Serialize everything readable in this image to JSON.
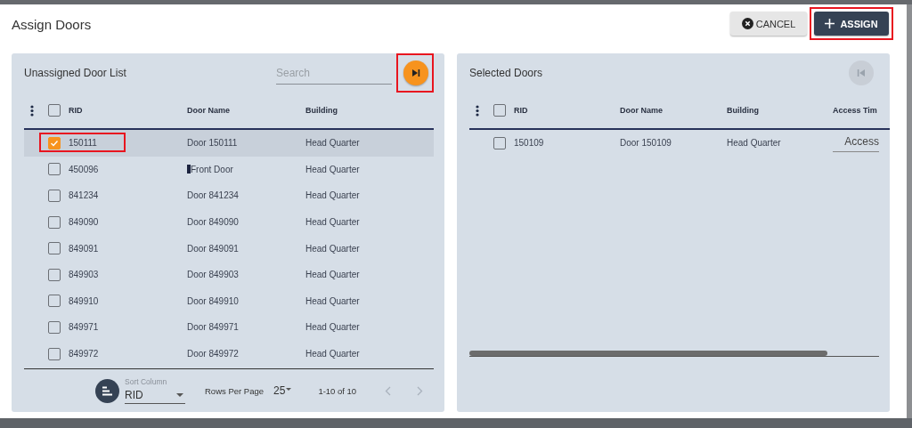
{
  "dialog": {
    "title": "Assign Doors"
  },
  "buttons": [
    {
      "label": "CANCEL",
      "kind": "cancel",
      "highlighted": false
    },
    {
      "label": "ASSIGN",
      "kind": "assign",
      "highlighted": true
    }
  ],
  "unassigned": {
    "title": "Unassigned Door List",
    "search": {
      "placeholder": "Search"
    },
    "move_button": {
      "kind": "move-all",
      "disabled": false,
      "highlighted": true
    },
    "columns": [
      "RID",
      "Door Name",
      "Building"
    ],
    "header_checked": false,
    "rows": [
      {
        "rid": "150111",
        "door_name": "Door 150111",
        "building": "Head Quarter",
        "checked": true,
        "selected": true,
        "highlighted": true,
        "cursor": false
      },
      {
        "rid": "450096",
        "door_name": "Front Door",
        "building": "Head Quarter",
        "checked": false,
        "selected": false,
        "highlighted": false,
        "cursor": true
      },
      {
        "rid": "841234",
        "door_name": "Door 841234",
        "building": "Head Quarter",
        "checked": false,
        "selected": false,
        "highlighted": false,
        "cursor": false
      },
      {
        "rid": "849090",
        "door_name": "Door 849090",
        "building": "Head Quarter",
        "checked": false,
        "selected": false,
        "highlighted": false,
        "cursor": false
      },
      {
        "rid": "849091",
        "door_name": "Door 849091",
        "building": "Head Quarter",
        "checked": false,
        "selected": false,
        "highlighted": false,
        "cursor": false
      },
      {
        "rid": "849903",
        "door_name": "Door 849903",
        "building": "Head Quarter",
        "checked": false,
        "selected": false,
        "highlighted": false,
        "cursor": false
      },
      {
        "rid": "849910",
        "door_name": "Door 849910",
        "building": "Head Quarter",
        "checked": false,
        "selected": false,
        "highlighted": false,
        "cursor": false
      },
      {
        "rid": "849971",
        "door_name": "Door 849971",
        "building": "Head Quarter",
        "checked": false,
        "selected": false,
        "highlighted": false,
        "cursor": false
      },
      {
        "rid": "849972",
        "door_name": "Door 849972",
        "building": "Head Quarter",
        "checked": false,
        "selected": false,
        "highlighted": false,
        "cursor": false
      }
    ],
    "sort": {
      "label": "Sort Column",
      "value": "RID"
    },
    "rows_per_page": {
      "label": "Rows Per Page",
      "value": "25"
    },
    "range": "1-10 of 10"
  },
  "selected_doors": {
    "title": "Selected Doors",
    "move_button": {
      "kind": "move-back",
      "disabled": true,
      "highlighted": false
    },
    "columns": [
      "RID",
      "Door Name",
      "Building",
      "Access Tim"
    ],
    "header_checked": false,
    "rows": [
      {
        "rid": "150109",
        "door_name": "Door 150109",
        "building": "Head Quarter",
        "access": "Access",
        "checked": false,
        "selected": false
      }
    ]
  }
}
